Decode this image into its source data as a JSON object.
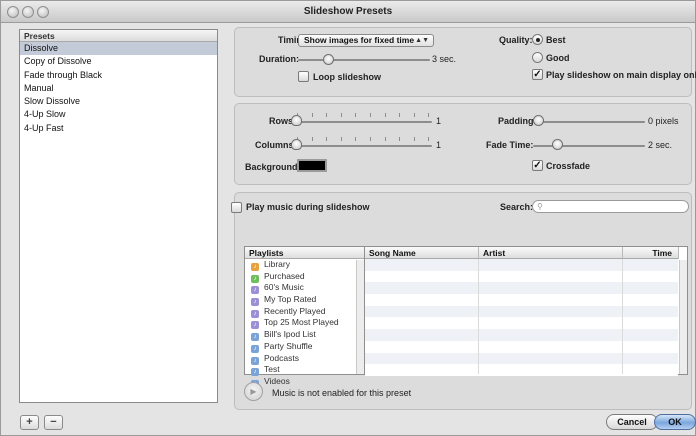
{
  "window": {
    "title": "Slideshow Presets"
  },
  "presets": {
    "header": "Presets",
    "items": [
      {
        "label": "Dissolve",
        "selected": true
      },
      {
        "label": "Copy of Dissolve",
        "selected": false
      },
      {
        "label": "Fade through Black",
        "selected": false
      },
      {
        "label": "Manual",
        "selected": false
      },
      {
        "label": "Slow Dissolve",
        "selected": false
      },
      {
        "label": "4-Up Slow",
        "selected": false
      },
      {
        "label": "4-Up Fast",
        "selected": false
      }
    ],
    "add_label": "+",
    "remove_label": "−"
  },
  "timing": {
    "timing_label": "Timing:",
    "timing_value": "Show images for fixed time",
    "duration_label": "Duration:",
    "duration_value": "3 sec.",
    "loop_label": "Loop slideshow",
    "loop_checked": false,
    "quality_label": "Quality:",
    "quality_options": [
      "Best",
      "Good"
    ],
    "quality_selected": "Best",
    "main_display_label": "Play slideshow on main display only",
    "main_display_checked": true
  },
  "layout": {
    "rows_label": "Rows:",
    "rows_value": "1",
    "columns_label": "Columns:",
    "columns_value": "1",
    "background_label": "Background:",
    "background_color": "#000000",
    "padding_label": "Padding:",
    "padding_value": "0 pixels",
    "fade_label": "Fade Time:",
    "fade_value": "2 sec.",
    "crossfade_label": "Crossfade",
    "crossfade_checked": true
  },
  "music": {
    "play_music_label": "Play music during slideshow",
    "play_music_checked": false,
    "search_label": "Search:",
    "search_placeholder": "",
    "playlists_header": "Playlists",
    "playlists": [
      {
        "name": "Library",
        "icon": "library-icon",
        "color": "#e6a23c"
      },
      {
        "name": "Purchased",
        "icon": "purchased-icon",
        "color": "#6fbf5c"
      },
      {
        "name": "60's Music",
        "icon": "smart-playlist-icon",
        "color": "#9d8fd6"
      },
      {
        "name": "My Top Rated",
        "icon": "smart-playlist-icon",
        "color": "#9d8fd6"
      },
      {
        "name": "Recently Played",
        "icon": "smart-playlist-icon",
        "color": "#9d8fd6"
      },
      {
        "name": "Top 25 Most Played",
        "icon": "smart-playlist-icon",
        "color": "#9d8fd6"
      },
      {
        "name": "Bill's Ipod List",
        "icon": "playlist-icon",
        "color": "#7aa4d8"
      },
      {
        "name": "Party Shuffle",
        "icon": "playlist-icon",
        "color": "#7aa4d8"
      },
      {
        "name": "Podcasts",
        "icon": "playlist-icon",
        "color": "#7aa4d8"
      },
      {
        "name": "Test",
        "icon": "playlist-icon",
        "color": "#7aa4d8"
      },
      {
        "name": "Videos",
        "icon": "playlist-icon",
        "color": "#7aa4d8"
      }
    ],
    "columns": [
      "Song Name",
      "Artist",
      "Time"
    ],
    "status_text": "Music is not enabled for this preset"
  },
  "buttons": {
    "cancel": "Cancel",
    "ok": "OK"
  }
}
